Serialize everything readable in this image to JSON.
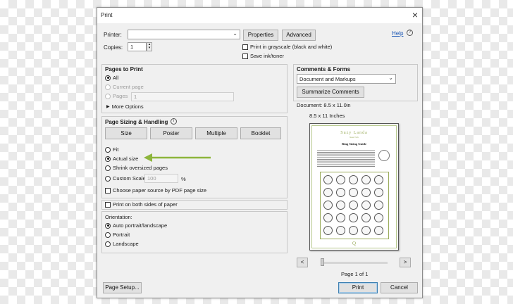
{
  "dialog": {
    "title": "Print",
    "help": "Help"
  },
  "printer": {
    "label": "Printer:",
    "value": "",
    "properties": "Properties",
    "advanced": "Advanced"
  },
  "copies": {
    "label": "Copies:",
    "value": "1"
  },
  "options": {
    "grayscale": "Print in grayscale (black and white)",
    "save_ink": "Save ink/toner"
  },
  "pages_to_print": {
    "title": "Pages to Print",
    "all": "All",
    "current": "Current page",
    "pages": "Pages",
    "pages_value": "1",
    "more": "More Options"
  },
  "sizing": {
    "title": "Page Sizing & Handling",
    "tabs": [
      "Size",
      "Poster",
      "Multiple",
      "Booklet"
    ],
    "fit": "Fit",
    "actual": "Actual size",
    "shrink": "Shrink oversized pages",
    "custom": "Custom Scale:",
    "custom_value": "100",
    "percent": "%",
    "paper_source": "Choose paper source by PDF page size"
  },
  "both_sides": "Print on both sides of paper",
  "orientation": {
    "title": "Orientation:",
    "auto": "Auto portrait/landscape",
    "portrait": "Portrait",
    "landscape": "Landscape"
  },
  "comments": {
    "title": "Comments & Forms",
    "select": "Document and Markups",
    "summarize": "Summarize Comments"
  },
  "preview": {
    "document": "Document: 8.5 x 11.0in",
    "paper": "8.5 x 11 Inches",
    "page_counter": "Page 1 of 1",
    "brand": "Suzy Landa",
    "brand_sub": "New York",
    "heading": "Ring Sizing Guide",
    "footer_mark": "Q"
  },
  "footer": {
    "page_setup": "Page Setup...",
    "print": "Print",
    "cancel": "Cancel"
  },
  "colors": {
    "accent_arrow": "#8db53c",
    "primary_border": "#3c7fb1",
    "link": "#1b57b5"
  },
  "icons": [
    "close-icon",
    "help-info-icon",
    "chevron-down-icon",
    "stepper-icon",
    "expand-triangle-icon",
    "info-icon",
    "arrow-icon",
    "prev-icon",
    "next-icon",
    "ring-icon"
  ]
}
